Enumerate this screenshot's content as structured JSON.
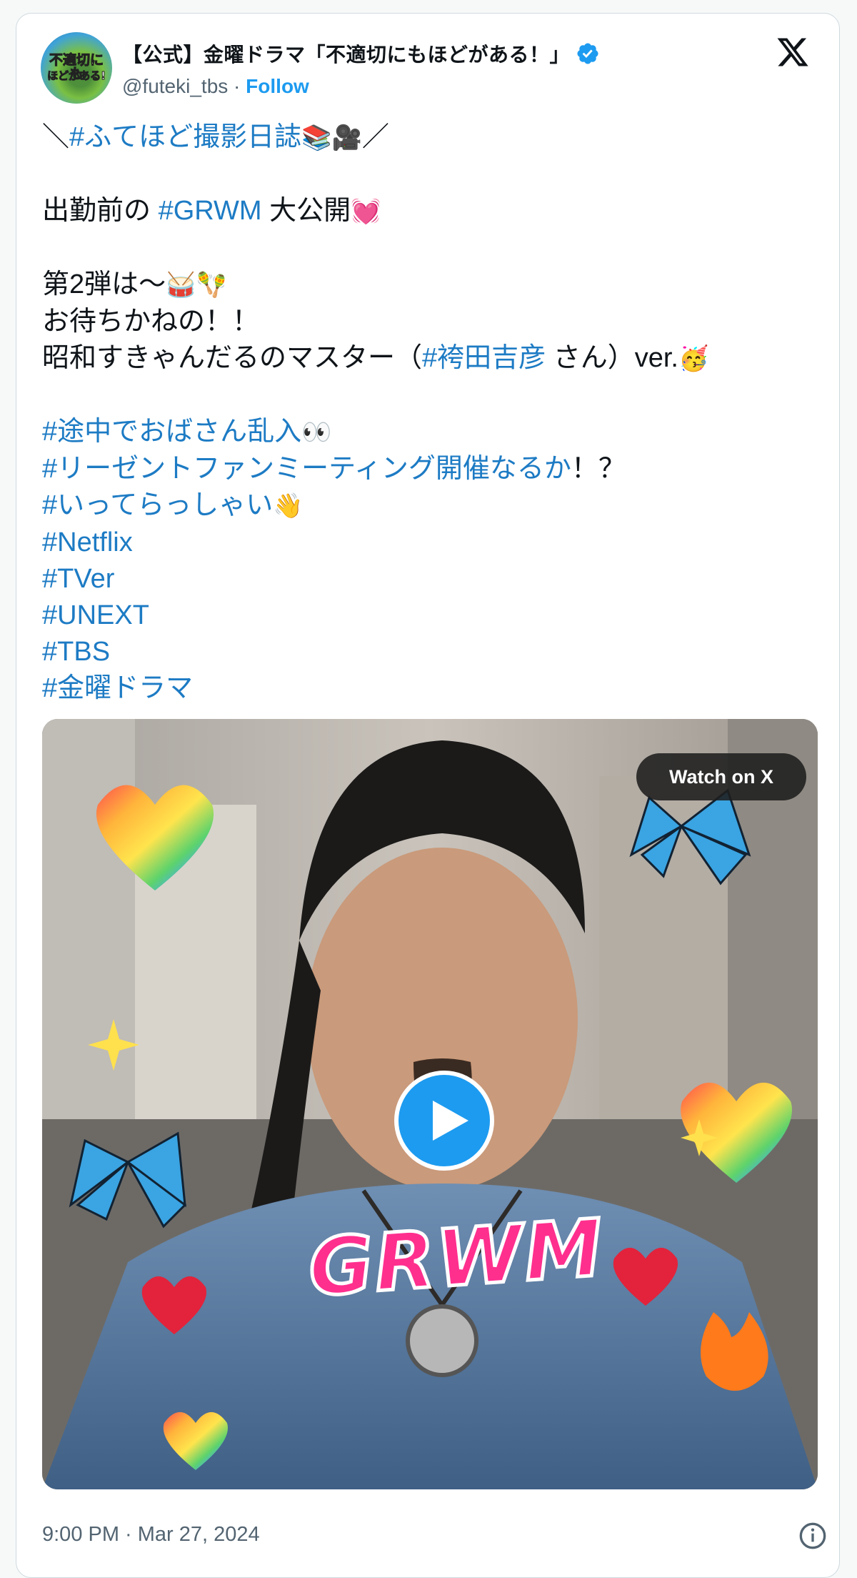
{
  "tweet": {
    "display_name": "【公式】金曜ドラマ「不適切にもほどがある！」",
    "handle": "@futeki_tbs",
    "separator": " · ",
    "follow_label": "Follow",
    "avatar_text_line1": "不適切にも",
    "avatar_text_line2": "ほどがある!",
    "verified": true,
    "brand_icon": "x-logo-icon",
    "text_lines": [
      {
        "parts": [
          {
            "t": "＼"
          },
          {
            "t": "#ふてほど撮影日誌",
            "h": true
          },
          {
            "t": "📚🎥",
            "e": true
          },
          {
            "t": "／"
          }
        ]
      },
      {
        "parts": [
          {
            "t": ""
          }
        ]
      },
      {
        "parts": [
          {
            "t": "出勤前の "
          },
          {
            "t": "#GRWM",
            "h": true
          },
          {
            "t": " 大公開"
          },
          {
            "t": "💓",
            "e": true
          }
        ]
      },
      {
        "parts": [
          {
            "t": ""
          }
        ]
      },
      {
        "parts": [
          {
            "t": "第2弾は〜"
          },
          {
            "t": "🥁🪇",
            "e": true
          }
        ]
      },
      {
        "parts": [
          {
            "t": "お待ちかねの！！"
          }
        ]
      },
      {
        "parts": [
          {
            "t": "昭和すきゃんだるのマスター（"
          },
          {
            "t": "#袴田吉彦",
            "h": true
          },
          {
            "t": " さん）ver."
          },
          {
            "t": "🥳",
            "e": true
          }
        ]
      },
      {
        "parts": [
          {
            "t": ""
          }
        ]
      },
      {
        "parts": [
          {
            "t": "#途中でおばさん乱入",
            "h": true
          },
          {
            "t": "👀",
            "e": true
          }
        ]
      },
      {
        "parts": [
          {
            "t": "#リーゼントファンミーティング開催なるか",
            "h": true
          },
          {
            "t": "！？"
          }
        ]
      },
      {
        "parts": [
          {
            "t": "#いってらっしゃい",
            "h": true
          },
          {
            "t": "👋",
            "e": true
          }
        ]
      },
      {
        "parts": [
          {
            "t": "#Netflix",
            "h": true
          }
        ]
      },
      {
        "parts": [
          {
            "t": "#TVer",
            "h": true
          }
        ]
      },
      {
        "parts": [
          {
            "t": "#UNEXT",
            "h": true
          }
        ]
      },
      {
        "parts": [
          {
            "t": "#TBS",
            "h": true
          }
        ]
      },
      {
        "parts": [
          {
            "t": "#金曜ドラマ",
            "h": true
          }
        ]
      }
    ],
    "media": {
      "watch_label": "Watch on X",
      "overlay_text": "GRWM",
      "play_icon": "play-icon"
    },
    "timestamp": "9:00 PM · Mar 27, 2024",
    "info_icon": "info-icon"
  },
  "colors": {
    "link": "#1d9bf0",
    "hashtag": "#1d7bc4",
    "text": "#0f1419",
    "muted": "#536471",
    "overlay_pink": "#ff2f8e"
  }
}
